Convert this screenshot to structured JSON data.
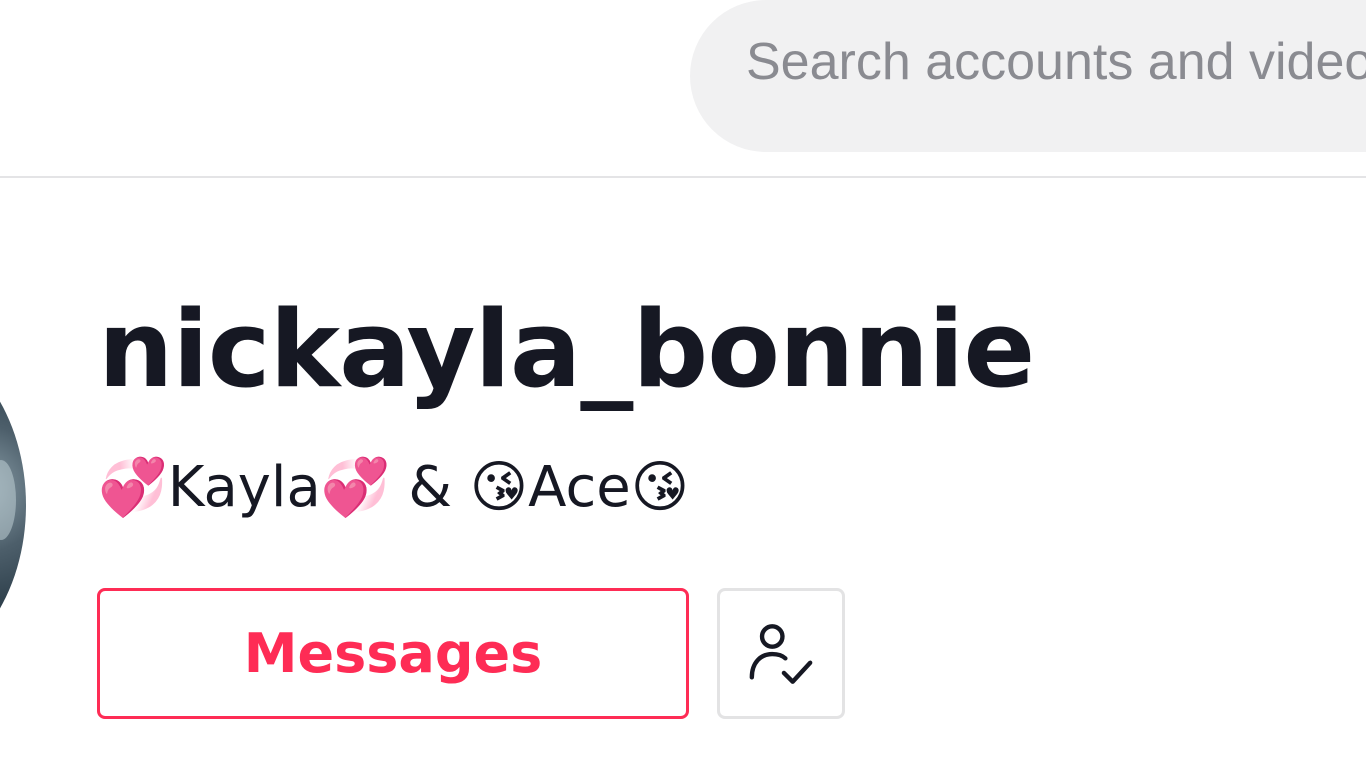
{
  "header": {
    "search": {
      "placeholder": "Search accounts and videos"
    }
  },
  "profile": {
    "username": "nickayla_bonnie",
    "nickname": "💞Kayla💞 & 😘Ace😘",
    "messages_label": "Messages",
    "following_icon": "user-check-icon"
  },
  "colors": {
    "accent": "#fe2c55",
    "text": "#161823",
    "search_bg": "#f1f1f2",
    "border": "#e3e3e4"
  }
}
